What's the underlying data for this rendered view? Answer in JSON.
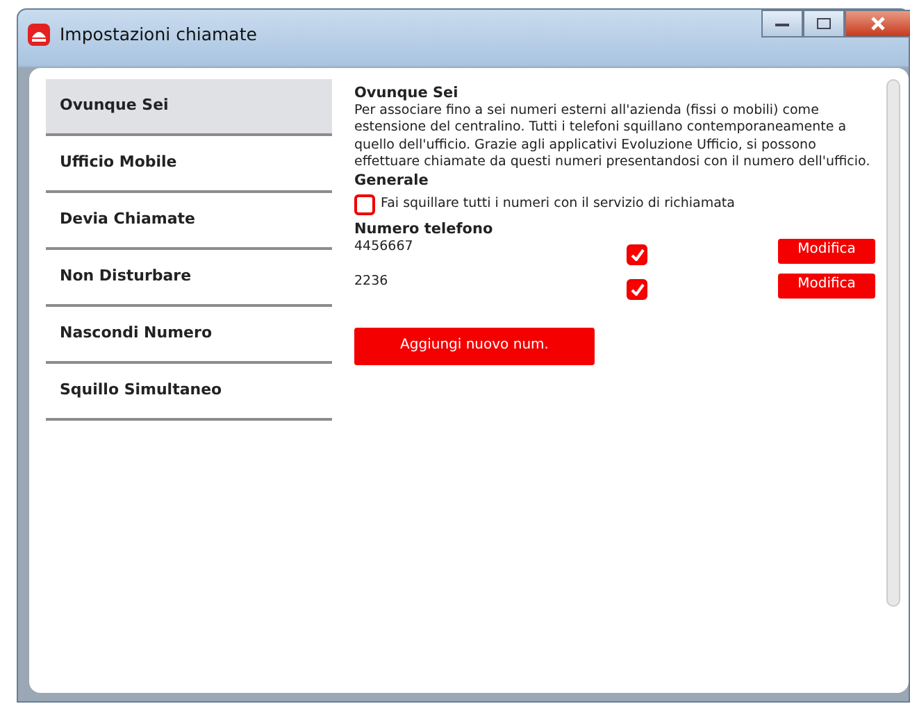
{
  "window": {
    "title": "Impostazioni chiamate"
  },
  "sidebar": {
    "items": [
      {
        "label": "Ovunque Sei",
        "selected": true
      },
      {
        "label": "Ufficio Mobile",
        "selected": false
      },
      {
        "label": "Devia Chiamate",
        "selected": false
      },
      {
        "label": "Non Disturbare",
        "selected": false
      },
      {
        "label": "Nascondi Numero",
        "selected": false
      },
      {
        "label": "Squillo Simultaneo",
        "selected": false
      }
    ]
  },
  "content": {
    "title": "Ovunque Sei",
    "description": "Per associare fino a sei numeri esterni all'azienda (fissi o mobili) come estensione del centralino. Tutti i telefoni squillano contemporaneamente a quello dell'ufficio. Grazie agli applicativi Evoluzione Ufficio, si possono effettuare chiamate da questi numeri presentandosi con il numero dell'ufficio.",
    "section": "Generale",
    "option": {
      "label": "Fai squillare tutti i numeri con il servizio di richiamata",
      "checked": false
    },
    "numbers_heading": "Numero telefono",
    "numbers": [
      {
        "number": "4456667",
        "checked": true,
        "button": "Modifica"
      },
      {
        "number": "2236",
        "checked": true,
        "button": "Modifica"
      }
    ],
    "add_button": "Aggiungi nuovo num."
  }
}
